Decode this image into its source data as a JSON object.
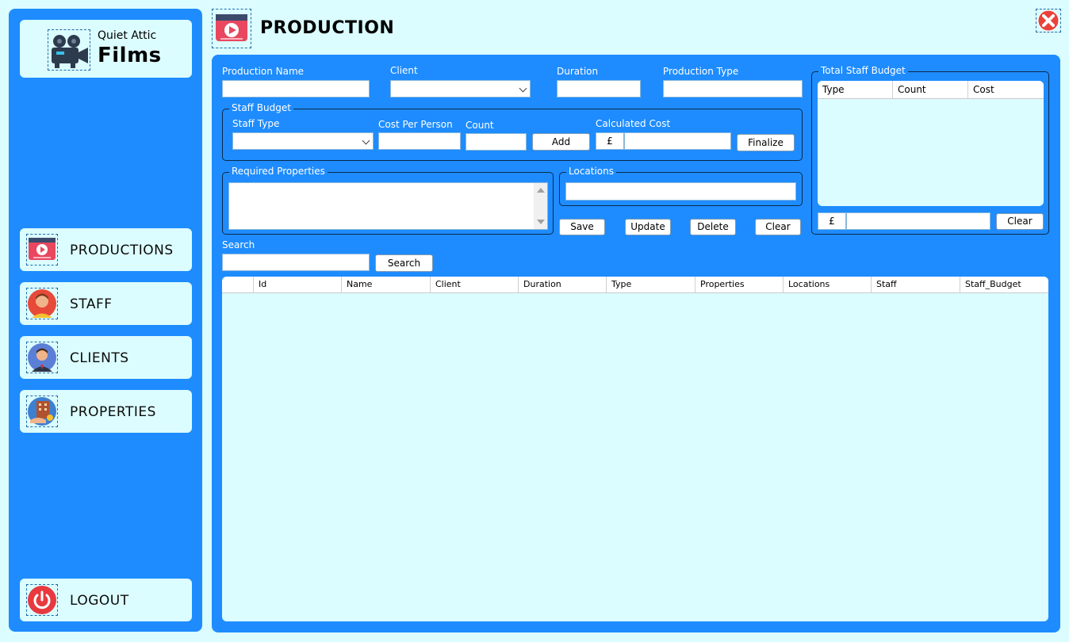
{
  "app": {
    "name_small": "Quiet Attic",
    "name_big": "Films"
  },
  "header": {
    "title": "PRODUCTION"
  },
  "sidebar": {
    "items": [
      {
        "label": "PRODUCTIONS",
        "icon": "video-player-icon"
      },
      {
        "label": "STAFF",
        "icon": "staff-avatar-icon"
      },
      {
        "label": "CLIENTS",
        "icon": "client-avatar-icon"
      },
      {
        "label": "PROPERTIES",
        "icon": "property-icon"
      }
    ],
    "logout": {
      "label": "LOGOUT",
      "icon": "power-icon"
    }
  },
  "form": {
    "production_name_label": "Production Name",
    "client_label": "Client",
    "duration_label": "Duration",
    "production_type_label": "Production Type",
    "staff_budget": {
      "title": "Staff Budget",
      "staff_type_label": "Staff Type",
      "cost_per_person_label": "Cost Per Person",
      "count_label": "Count",
      "add_label": "Add",
      "calculated_cost_label": "Calculated Cost",
      "currency": "£",
      "finalize_label": "Finalize"
    },
    "required_properties_label": "Required Properties",
    "locations_label": "Locations",
    "save_label": "Save",
    "update_label": "Update",
    "delete_label": "Delete",
    "clear_label": "Clear",
    "search_label": "Search",
    "search_button": "Search"
  },
  "total_budget": {
    "title": "Total Staff Budget",
    "columns": [
      "Type",
      "Count",
      "Cost"
    ],
    "currency": "£",
    "clear_label": "Clear"
  },
  "grid": {
    "columns": [
      "Id",
      "Name",
      "Client",
      "Duration",
      "Type",
      "Properties",
      "Locations",
      "Staff",
      "Staff_Budget"
    ]
  },
  "colors": {
    "panel": "#1e8cff",
    "background": "#dcfdff",
    "close": "#e8433a"
  }
}
